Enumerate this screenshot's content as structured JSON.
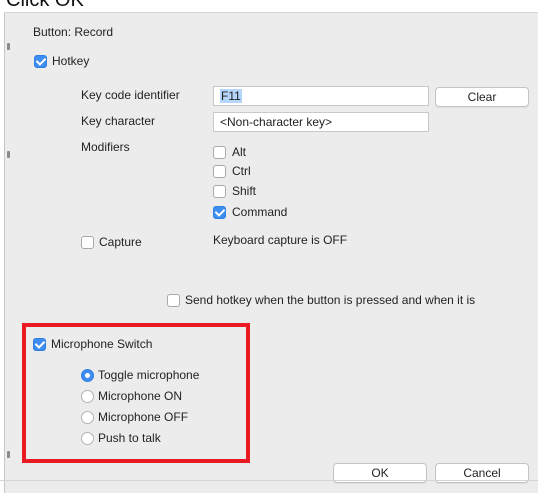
{
  "caption": "Click OK",
  "dialog": {
    "title": "Button: Record"
  },
  "hotkey": {
    "label": "Hotkey",
    "checked": true,
    "key_code_label": "Key code identifier",
    "key_code_value": "F11",
    "clear_label": "Clear",
    "key_character_label": "Key character",
    "key_character_value": "<Non-character key>",
    "modifiers_label": "Modifiers",
    "modifiers": [
      {
        "label": "Alt",
        "checked": false
      },
      {
        "label": "Ctrl",
        "checked": false
      },
      {
        "label": "Shift",
        "checked": false
      },
      {
        "label": "Command",
        "checked": true
      }
    ],
    "capture_label": "Capture",
    "capture_checked": false,
    "capture_status": "Keyboard capture is OFF",
    "send_hotkey_label": "Send hotkey when the button is pressed and when it is",
    "send_hotkey_checked": false
  },
  "microphone": {
    "label": "Microphone Switch",
    "checked": true,
    "options": [
      {
        "label": "Toggle microphone",
        "selected": true
      },
      {
        "label": "Microphone ON",
        "selected": false
      },
      {
        "label": "Microphone OFF",
        "selected": false
      },
      {
        "label": "Push to talk",
        "selected": false
      }
    ]
  },
  "footer": {
    "ok_label": "OK",
    "cancel_label": "Cancel"
  },
  "colors": {
    "accent": "#3e8df1",
    "highlight": "#ea1a23",
    "panel": "#ececec"
  }
}
